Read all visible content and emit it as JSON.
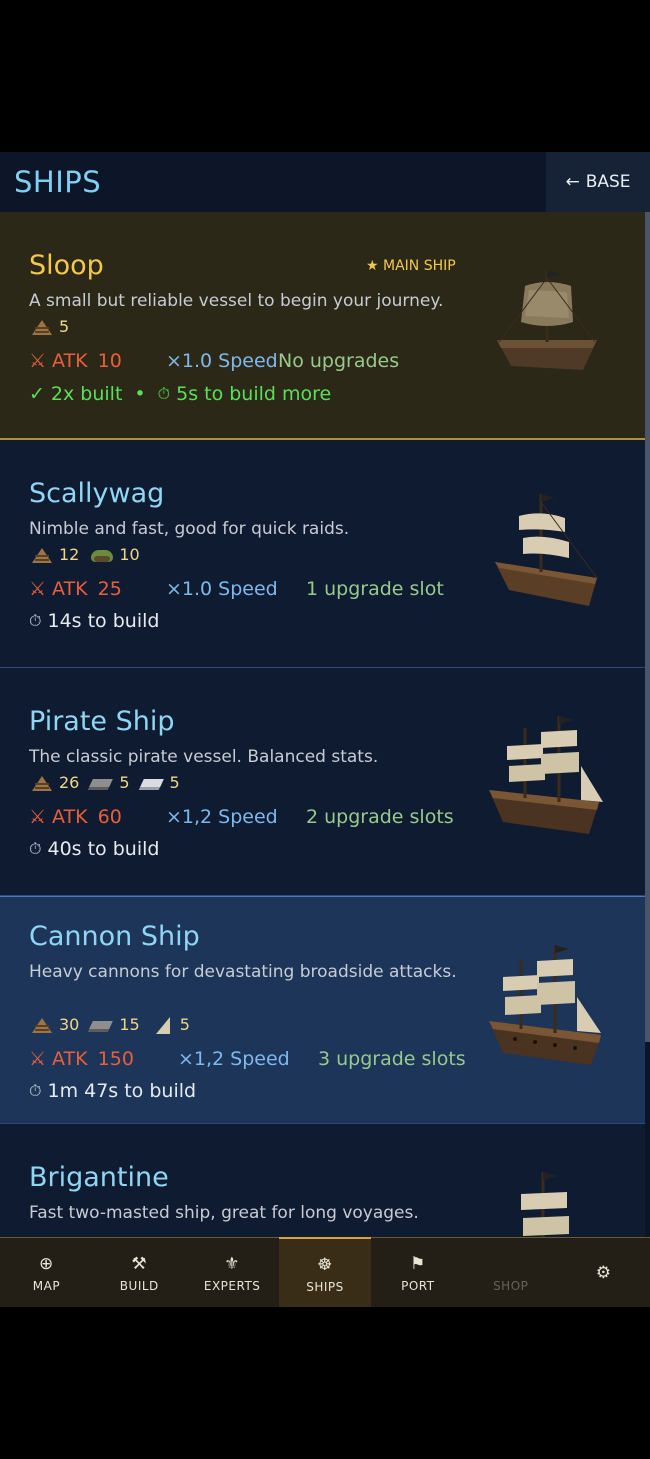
{
  "header": {
    "title": "SHIPS",
    "base_label": "BASE",
    "back_arrow": "←"
  },
  "ships": [
    {
      "name": "Sloop",
      "badge": "★ MAIN SHIP",
      "description": "A small but reliable vessel to begin your journey.",
      "resources": [
        {
          "icon": "wood-icon",
          "amount": "5"
        }
      ],
      "atk_label": "ATK",
      "atk_value": "10",
      "speed": "×1.0 Speed",
      "upgrades": "No upgrades",
      "built": "2x built",
      "separator": "•",
      "build_time": "5s to build more",
      "art_icon": "sloop-ship-illustration"
    },
    {
      "name": "Scallywag",
      "description": "Nimble and fast, good for quick raids.",
      "resources": [
        {
          "icon": "wood-icon",
          "amount": "12"
        },
        {
          "icon": "herb-icon",
          "amount": "10"
        }
      ],
      "atk_label": "ATK",
      "atk_value": "25",
      "speed": "×1.0 Speed",
      "upgrades": "1 upgrade slot",
      "build_time": "14s to build",
      "art_icon": "scallywag-ship-illustration"
    },
    {
      "name": "Pirate Ship",
      "description": "The classic pirate vessel. Balanced stats.",
      "resources": [
        {
          "icon": "wood-icon",
          "amount": "26"
        },
        {
          "icon": "iron-icon",
          "amount": "5"
        },
        {
          "icon": "silver-icon",
          "amount": "5"
        }
      ],
      "atk_label": "ATK",
      "atk_value": "60",
      "speed": "×1,2 Speed",
      "upgrades": "2 upgrade slots",
      "build_time": "40s to build",
      "art_icon": "pirate-ship-illustration"
    },
    {
      "name": "Cannon Ship",
      "description": "Heavy cannons for devastating broadside attacks.",
      "resources": [
        {
          "icon": "wood-icon",
          "amount": "30"
        },
        {
          "icon": "iron-icon",
          "amount": "15"
        },
        {
          "icon": "sail-icon",
          "amount": "5"
        }
      ],
      "atk_label": "ATK",
      "atk_value": "150",
      "speed": "×1,2 Speed",
      "upgrades": "3 upgrade slots",
      "build_time": "1m 47s to build",
      "art_icon": "cannon-ship-illustration"
    },
    {
      "name": "Brigantine",
      "description": "Fast two-masted ship, great for long voyages.",
      "art_icon": "brigantine-ship-illustration"
    }
  ],
  "nav": [
    {
      "label": "MAP",
      "icon": "⊕",
      "icon_name": "map-icon"
    },
    {
      "label": "BUILD",
      "icon": "⚒",
      "icon_name": "build-icon"
    },
    {
      "label": "EXPERTS",
      "icon": "⚜",
      "icon_name": "experts-icon"
    },
    {
      "label": "SHIPS",
      "icon": "☸",
      "icon_name": "ship-wheel-icon"
    },
    {
      "label": "PORT",
      "icon": "⚑",
      "icon_name": "flag-icon"
    },
    {
      "label": "SHOP",
      "icon": "",
      "icon_name": ""
    },
    {
      "label": "",
      "icon": "⚙",
      "icon_name": "settings-icon"
    }
  ],
  "colors": {
    "accent": "#7fd0f0",
    "gold": "#f3c94a",
    "atk": "#e85f3c",
    "speed": "#7fb8ec",
    "upgrades": "#98c98d",
    "built": "#58e058"
  }
}
